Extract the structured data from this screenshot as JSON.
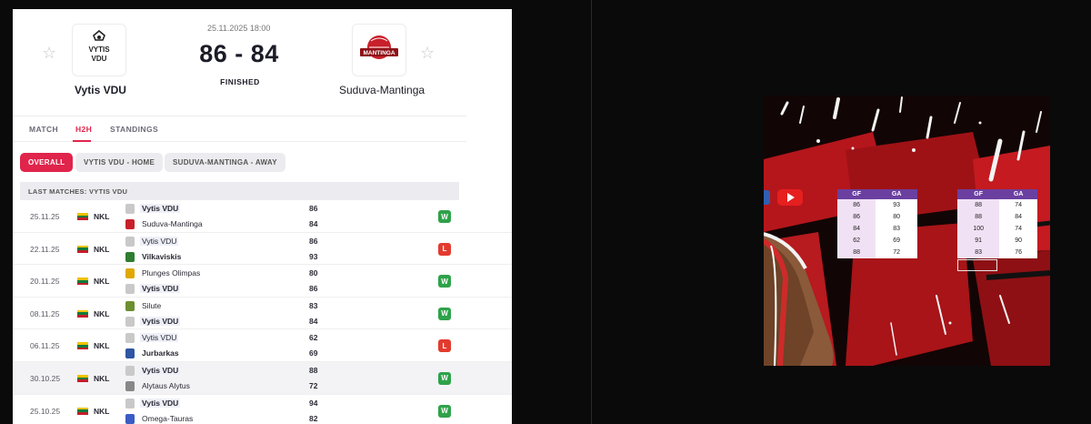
{
  "match": {
    "datetime": "25.11.2025 18:00",
    "score": "86 - 84",
    "status": "FINISHED",
    "home_team": "Vytis VDU",
    "away_team": "Suduva-Mantinga"
  },
  "tabs": [
    "MATCH",
    "H2H",
    "STANDINGS"
  ],
  "active_tab": "H2H",
  "filters": [
    "OVERALL",
    "VYTIS VDU - HOME",
    "SUDUVA-MANTINGA - AWAY"
  ],
  "active_filter": "OVERALL",
  "section_title": "LAST MATCHES: VYTIS VDU",
  "matches": [
    {
      "date": "25.11.25",
      "league": "NKL",
      "team1": "Vytis VDU",
      "score1": "86",
      "team2": "Suduva-Mantinga",
      "score2": "84",
      "result": "W"
    },
    {
      "date": "22.11.25",
      "league": "NKL",
      "team1": "Vytis VDU",
      "score1": "86",
      "team2": "Vilkaviskis",
      "score2": "93",
      "result": "L"
    },
    {
      "date": "20.11.25",
      "league": "NKL",
      "team1": "Plunges Olimpas",
      "score1": "80",
      "team2": "Vytis VDU",
      "score2": "86",
      "result": "W"
    },
    {
      "date": "08.11.25",
      "league": "NKL",
      "team1": "Silute",
      "score1": "83",
      "team2": "Vytis VDU",
      "score2": "84",
      "result": "W"
    },
    {
      "date": "06.11.25",
      "league": "NKL",
      "team1": "Vytis VDU",
      "score1": "62",
      "team2": "Jurbarkas",
      "score2": "69",
      "result": "L"
    },
    {
      "date": "30.10.25",
      "league": "NKL",
      "team1": "Vytis VDU",
      "score1": "88",
      "team2": "Alytaus Alytus",
      "score2": "72",
      "result": "W"
    },
    {
      "date": "25.10.25",
      "league": "NKL",
      "team1": "Vytis VDU",
      "score1": "94",
      "team2": "Omega-Tauras",
      "score2": "82",
      "result": "W"
    }
  ],
  "overlay_tables": [
    {
      "headers": [
        "GF",
        "GA"
      ],
      "rows": [
        [
          "86",
          "93"
        ],
        [
          "86",
          "80"
        ],
        [
          "84",
          "83"
        ],
        [
          "62",
          "69"
        ],
        [
          "88",
          "72"
        ]
      ]
    },
    {
      "headers": [
        "GF",
        "GA"
      ],
      "rows": [
        [
          "88",
          "74"
        ],
        [
          "88",
          "84"
        ],
        [
          "100",
          "74"
        ],
        [
          "91",
          "90"
        ],
        [
          "83",
          "76"
        ]
      ]
    }
  ],
  "colors": {
    "accent": "#e0244b",
    "win": "#2fa24a",
    "loss": "#e23b2e",
    "overlay_header": "#6b3fa0"
  },
  "icons": {
    "favorite": "star-outline-icon",
    "video": "youtube-icon"
  },
  "logo_lettering": {
    "home": "VYTIS VDU",
    "away": "MANTINGA"
  }
}
